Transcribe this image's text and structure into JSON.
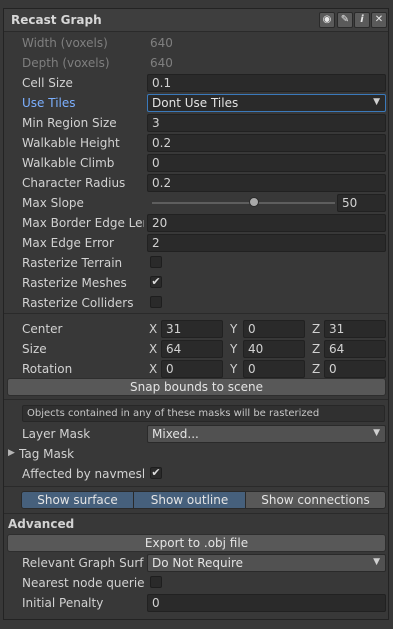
{
  "header": {
    "title": "Recast Graph"
  },
  "header_icons": [
    "eye-icon",
    "pencil-icon",
    "info-icon",
    "close-icon"
  ],
  "header_icon_glyphs": {
    "eye": "◉",
    "pencil": "✎",
    "info": "i",
    "close": "✕"
  },
  "fields": {
    "width": {
      "label": "Width (voxels)",
      "value": "640"
    },
    "depth": {
      "label": "Depth (voxels)",
      "value": "640"
    },
    "cell_size": {
      "label": "Cell Size",
      "value": "0.1"
    },
    "use_tiles": {
      "label": "Use Tiles",
      "value": "Dont Use Tiles"
    },
    "min_region_size": {
      "label": "Min Region Size",
      "value": "3"
    },
    "walkable_height": {
      "label": "Walkable Height",
      "value": "0.2"
    },
    "walkable_climb": {
      "label": "Walkable Climb",
      "value": "0"
    },
    "character_radius": {
      "label": "Character Radius",
      "value": "0.2"
    },
    "max_slope": {
      "label": "Max Slope",
      "value": "50",
      "slider_fraction": 0.555
    },
    "max_border_edge_length": {
      "label": "Max Border Edge Length",
      "value": "20"
    },
    "max_edge_error": {
      "label": "Max Edge Error",
      "value": "2"
    },
    "rasterize_terrain": {
      "label": "Rasterize Terrain",
      "checked": false
    },
    "rasterize_meshes": {
      "label": "Rasterize Meshes",
      "checked": true
    },
    "rasterize_colliders": {
      "label": "Rasterize Colliders",
      "checked": false
    }
  },
  "bounds": {
    "center": {
      "label": "Center",
      "x": "31",
      "y": "0",
      "z": "31"
    },
    "size": {
      "label": "Size",
      "x": "64",
      "y": "40",
      "z": "64"
    },
    "rotation": {
      "label": "Rotation",
      "x": "0",
      "y": "0",
      "z": "0"
    },
    "axis_x": "X",
    "axis_y": "Y",
    "axis_z": "Z",
    "snap_button": "Snap bounds to scene"
  },
  "masks": {
    "help": "Objects contained in any of these masks will be rasterized",
    "layer_mask": {
      "label": "Layer Mask",
      "value": "Mixed..."
    },
    "tag_mask": {
      "label": "Tag Mask"
    },
    "affected_by_navmesh": {
      "label": "Affected by navmesh",
      "checked": true
    }
  },
  "show_toggles": {
    "surface": "Show surface",
    "outline": "Show outline",
    "connections": "Show connections"
  },
  "advanced": {
    "title": "Advanced",
    "export_button": "Export to .obj file",
    "relevant_graph_surface": {
      "label": "Relevant Graph Surface",
      "value": "Do Not Require"
    },
    "nearest_node_queries": {
      "label": "Nearest node queries",
      "checked": false
    },
    "initial_penalty": {
      "label": "Initial Penalty",
      "value": "0"
    }
  },
  "glyphs": {
    "dropdown_arrow": "▼",
    "foldout_arrow": "▶",
    "check": "✔"
  }
}
